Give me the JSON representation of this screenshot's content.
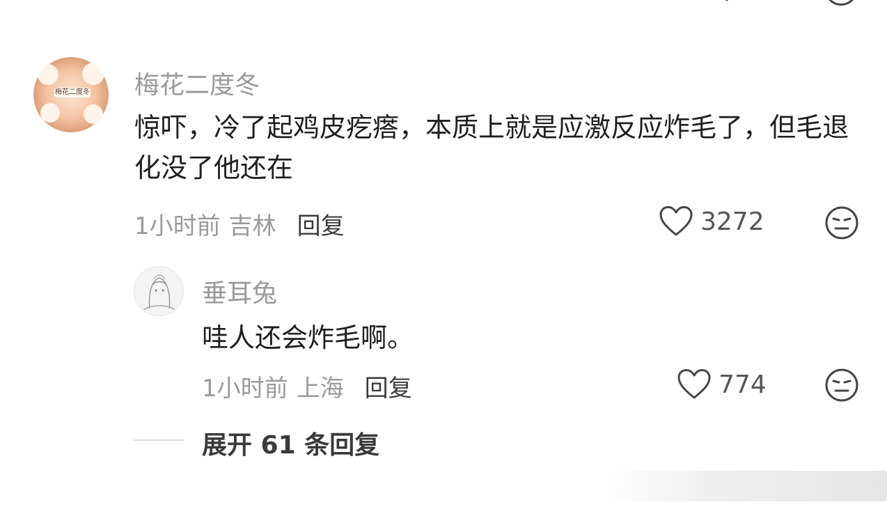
{
  "comment": {
    "username": "梅花二度冬",
    "avatar_text": "梅花二度冬",
    "content": "惊吓，冷了起鸡皮疙瘩，本质上就是应激反应炸毛了，但毛退化没了他还在",
    "time": "1小时前",
    "location": "吉林",
    "reply_label": "回复",
    "likes": "3272"
  },
  "reply": {
    "username": "垂耳兔",
    "content": "哇人还会炸毛啊。",
    "time": "1小时前",
    "location": "上海",
    "reply_label": "回复",
    "likes": "774"
  },
  "expand_label": "展开 61 条回复",
  "icons": {
    "like": "heart-icon",
    "emoji": "neutral-face-icon"
  }
}
